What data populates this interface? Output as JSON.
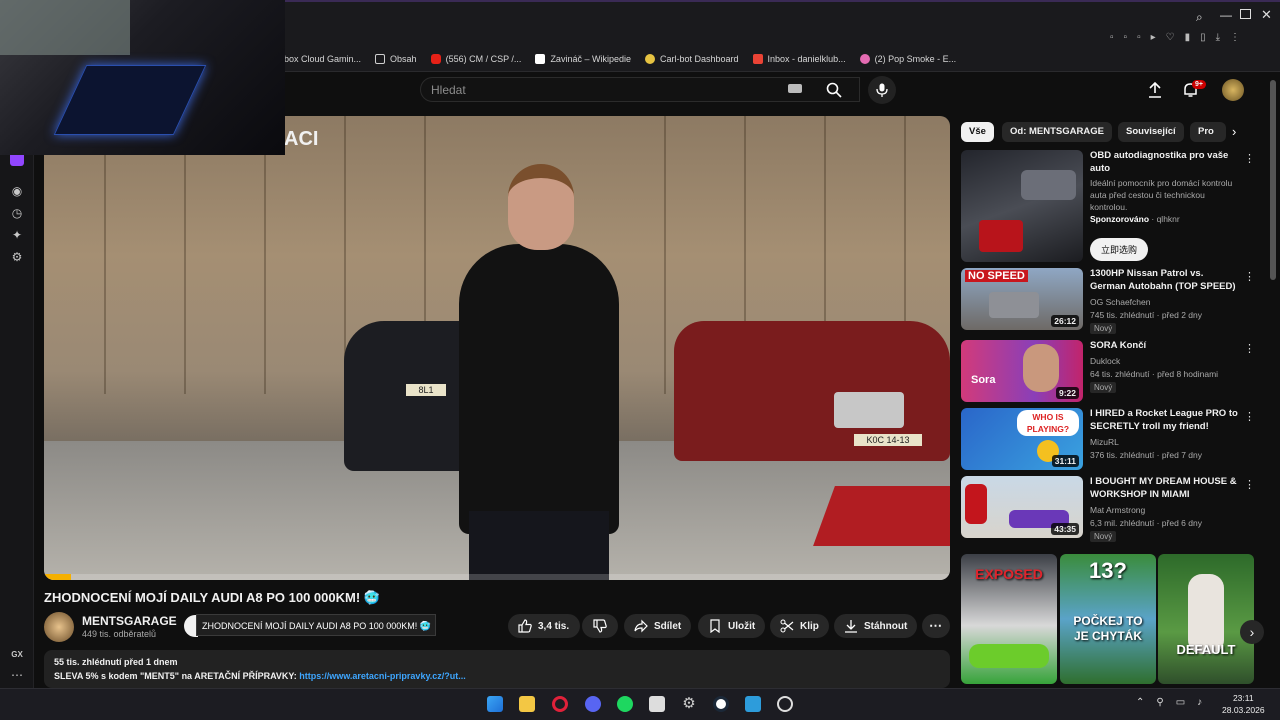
{
  "bookmarks": [
    {
      "label": "box Cloud Gamin...",
      "color": "#3a7be0"
    },
    {
      "label": "Obsah",
      "color": "#cfcfcf"
    },
    {
      "label": "(556) CM / CSP /...",
      "color": "#e62117"
    },
    {
      "label": "Zavináč – Wikipedie",
      "color": "#ffffff"
    },
    {
      "label": "Carl-bot Dashboard",
      "color": "#e6c342"
    },
    {
      "label": "Inbox - danielklub...",
      "color": "#ea4335"
    },
    {
      "label": "(2) Pop Smoke - E...",
      "color": "#e46bb2"
    }
  ],
  "search": {
    "placeholder": "Hledat"
  },
  "header": {
    "notifications_badge": "9+"
  },
  "video": {
    "overlay_text": "ACI",
    "plate_left": "8L1",
    "plate_right": "K0C 14-13",
    "progress": 0.03
  },
  "title": "ZHODNOCENÍ MOJÍ DAILY AUDI A8 PO 100 000KM! 🥶",
  "channel": {
    "name": "MENTSGARAGE",
    "subs": "449 tis. odběratelů"
  },
  "tooltip": "ZHODNOCENÍ MOJÍ DAILY AUDI A8 PO 100 000KM! 🥶",
  "actions": {
    "likes": "3,4 tis.",
    "share": "Sdílet",
    "save": "Uložit",
    "clip": "Klip",
    "download": "Stáhnout"
  },
  "description": {
    "stats": "55 tis. zhlédnutí  před 1 dnem",
    "line": "SLEVA 5% s kodem \"MENT5\"  na ARETAČNÍ PŘÍPRAVKY: ",
    "link": "https://www.aretacni-pripravky.cz/?ut..."
  },
  "chips": [
    "Vše",
    "Od: MENTSGARAGE",
    "Související",
    "Pro"
  ],
  "recommendations": [
    {
      "title": "OBD autodiagnostika pro vaše auto",
      "desc": "Ideální pomocník pro domácí kontrolu auta před cestou či technickou kontrolou.",
      "sponsor": "Sponzorováno",
      "sponsor_by": " · qlhknr",
      "cta": "立即选购"
    },
    {
      "title": "1300HP Nissan Patrol vs. German Autobahn (TOP SPEED)",
      "channel": "OG Schaefchen",
      "meta": "745 tis. zhlédnutí · před 2 dny",
      "badge": "Nový",
      "duration": "26:12",
      "thumb_text": "NO SPEED"
    },
    {
      "title": "SORA Končí",
      "channel": "Duklock",
      "meta": "64 tis. zhlédnutí · před 8 hodinami",
      "badge": "Nový",
      "duration": "9:22",
      "thumb_text": "Sora"
    },
    {
      "title": "I HIRED a Rocket League PRO to SECRETLY troll my friend!",
      "channel": "MizuRL",
      "meta": "376 tis. zhlédnutí · před 7 dny",
      "duration": "31:11",
      "thumb_text": "WHO IS PLAYING?"
    },
    {
      "title": "I BOUGHT MY DREAM HOUSE & WORKSHOP IN MIAMI",
      "channel": "Mat Armstrong",
      "meta": "6,3 mil. zhlédnutí · před 6 dny",
      "badge": "Nový",
      "duration": "43:35"
    }
  ],
  "shorts": [
    {
      "text": "EXPOSED"
    },
    {
      "text": "13?",
      "text2": "POČKEJ TO JE CHYTÁK"
    },
    {
      "text": "DEFAULT"
    }
  ],
  "sidebar_label": "GX",
  "clock": {
    "time": "23:11",
    "date": "28.03.2026"
  }
}
